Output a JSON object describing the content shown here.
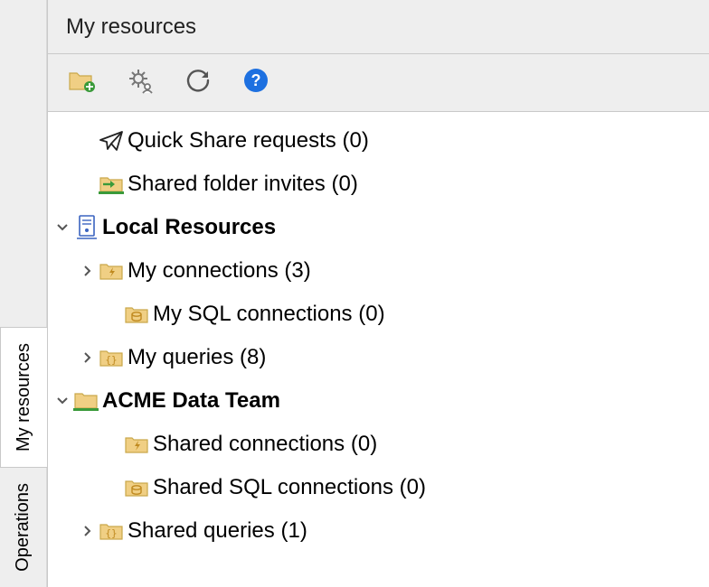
{
  "panel": {
    "title": "My resources"
  },
  "rail": {
    "tabs": [
      {
        "id": "my-resources",
        "label": "My resources",
        "active": true
      },
      {
        "id": "operations",
        "label": "Operations",
        "active": false
      }
    ]
  },
  "toolbar": {
    "buttons": [
      {
        "id": "new-folder",
        "icon": "new-folder-icon"
      },
      {
        "id": "settings",
        "icon": "gear-user-icon"
      },
      {
        "id": "refresh",
        "icon": "refresh-icon"
      },
      {
        "id": "help",
        "icon": "help-icon"
      }
    ]
  },
  "tree": {
    "nodes": [
      {
        "id": "quick-share",
        "label": "Quick Share requests",
        "count": 0,
        "icon": "paper-plane-icon",
        "depth": 1,
        "expandable": false
      },
      {
        "id": "shared-folder-invites",
        "label": "Shared folder invites",
        "count": 0,
        "icon": "shared-folder-arrow-icon",
        "depth": 1,
        "expandable": false
      },
      {
        "id": "local-resources",
        "label": "Local Resources",
        "count": null,
        "icon": "server-icon",
        "depth": 0,
        "expandable": true,
        "expanded": true,
        "bold": true
      },
      {
        "id": "my-connections",
        "label": "My connections",
        "count": 3,
        "icon": "folder-bolt-icon",
        "depth": 1,
        "expandable": true,
        "expanded": false
      },
      {
        "id": "my-sql-connections",
        "label": "My SQL connections",
        "count": 0,
        "icon": "folder-sql-icon",
        "depth": 2,
        "expandable": false
      },
      {
        "id": "my-queries",
        "label": "My queries",
        "count": 8,
        "icon": "folder-braces-icon",
        "depth": 1,
        "expandable": true,
        "expanded": false
      },
      {
        "id": "acme-team",
        "label": "ACME Data Team",
        "count": null,
        "icon": "team-folder-icon",
        "depth": 0,
        "expandable": true,
        "expanded": true,
        "bold": true
      },
      {
        "id": "shared-connections",
        "label": "Shared connections",
        "count": 0,
        "icon": "folder-bolt-icon",
        "depth": 2,
        "expandable": false
      },
      {
        "id": "shared-sql-connections",
        "label": "Shared SQL connections",
        "count": 0,
        "icon": "folder-sql-icon",
        "depth": 2,
        "expandable": false
      },
      {
        "id": "shared-queries",
        "label": "Shared queries",
        "count": 1,
        "icon": "folder-braces-icon",
        "depth": 1,
        "expandable": true,
        "expanded": false
      }
    ]
  },
  "colors": {
    "folder_fill": "#f0cf84",
    "folder_stroke": "#c9a84a",
    "help_blue": "#1d70e0",
    "share_green": "#3a9a3a"
  }
}
